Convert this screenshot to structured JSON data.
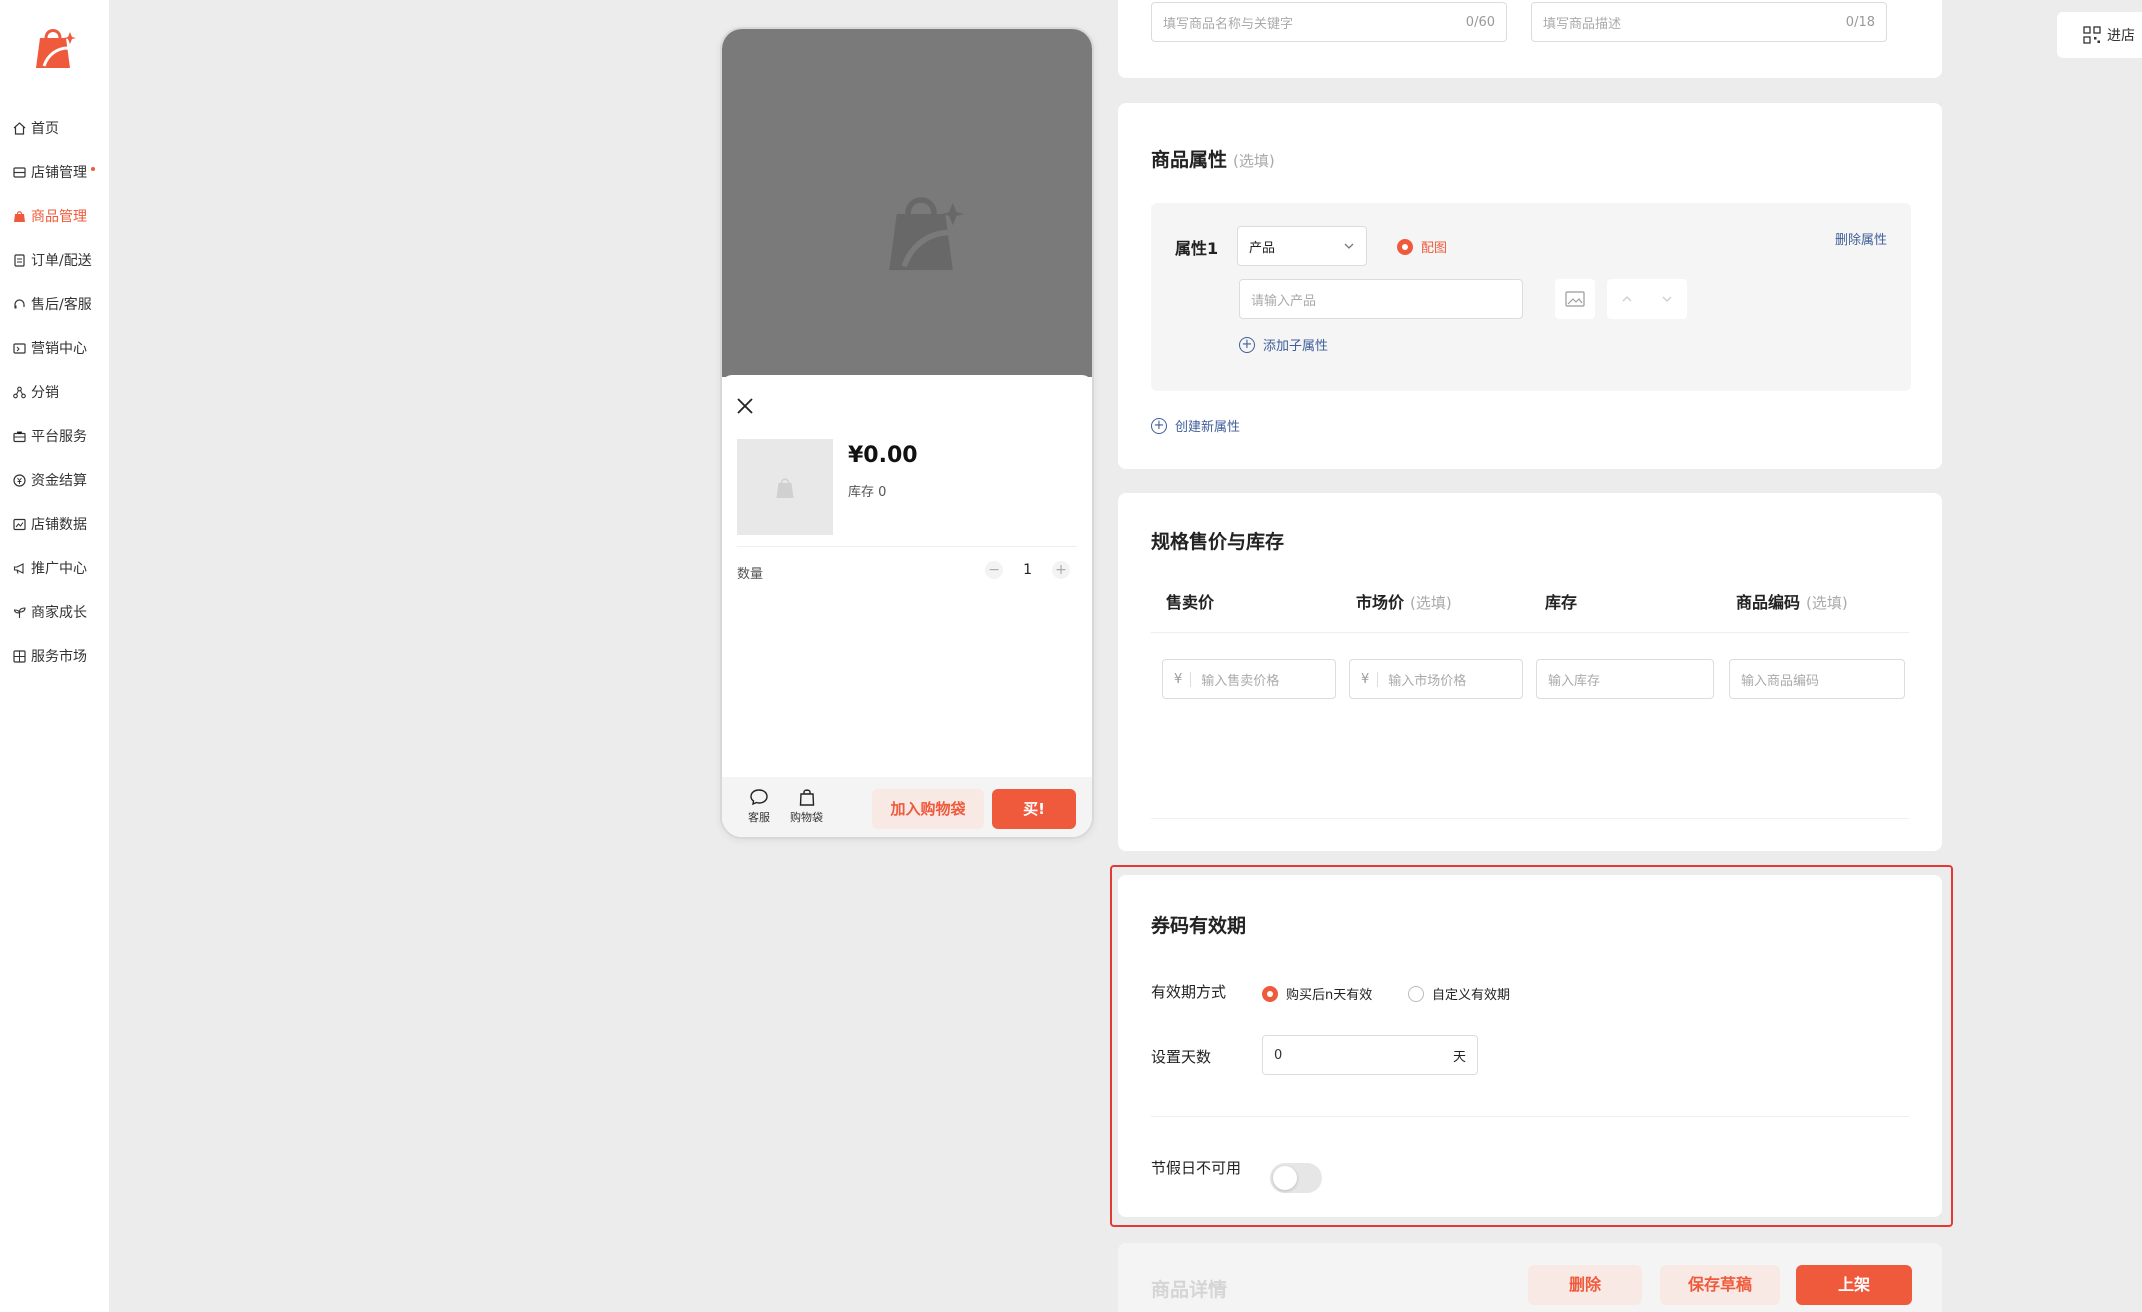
{
  "sidebar": {
    "items": [
      {
        "label": "首页",
        "icon": "home-icon"
      },
      {
        "label": "店铺管理",
        "icon": "store-icon",
        "dot": true
      },
      {
        "label": "商品管理",
        "icon": "goods-icon",
        "active": true
      },
      {
        "label": "订单/配送",
        "icon": "order-icon"
      },
      {
        "label": "售后/客服",
        "icon": "headset-icon"
      },
      {
        "label": "营销中心",
        "icon": "marketing-icon"
      },
      {
        "label": "分销",
        "icon": "distribution-icon"
      },
      {
        "label": "平台服务",
        "icon": "briefcase-icon"
      },
      {
        "label": "资金结算",
        "icon": "money-icon"
      },
      {
        "label": "店铺数据",
        "icon": "chart-icon"
      },
      {
        "label": "推广中心",
        "icon": "megaphone-icon"
      },
      {
        "label": "商家成长",
        "icon": "sprout-icon"
      },
      {
        "label": "服务市场",
        "icon": "grid-icon"
      }
    ]
  },
  "colors": {
    "accent": "#f05a3c",
    "link": "#3f5e9a",
    "highlight": "#e53935"
  },
  "preview": {
    "price": "¥0.00",
    "stock": "库存 0",
    "qty_label": "数量",
    "qty_minus": "−",
    "qty_value": "1",
    "qty_plus": "+",
    "service_label": "客服",
    "bag_label": "购物袋",
    "add_cart": "加入购物袋",
    "buy": "买!"
  },
  "basic": {
    "name_placeholder": "填写商品名称与关键字",
    "name_counter": "0/60",
    "desc_placeholder": "填写商品描述",
    "desc_counter": "0/18"
  },
  "attributes": {
    "title": "商品属性",
    "optional": "(选填)",
    "attr_label": "属性1",
    "attr_select": "产品",
    "image_toggle": "配图",
    "delete_attr": "删除属性",
    "value_placeholder": "请输入产品",
    "add_sub": "添加子属性",
    "create_new": "创建新属性"
  },
  "pricing": {
    "title": "规格售价与库存",
    "col_price": "售卖价",
    "col_market": "市场价",
    "col_market_opt": "(选填)",
    "col_stock": "库存",
    "col_code": "商品编码",
    "col_code_opt": "(选填)",
    "currency": "¥",
    "price_placeholder": "输入售卖价格",
    "market_placeholder": "输入市场价格",
    "stock_placeholder": "输入库存",
    "code_placeholder": "输入商品编码"
  },
  "validity": {
    "title": "券码有效期",
    "mode_label": "有效期方式",
    "option1": "购买后n天有效",
    "option2": "自定义有效期",
    "days_label": "设置天数",
    "days_value": "0",
    "days_unit": "天",
    "holiday_label": "节假日不可用",
    "holiday_enabled": false
  },
  "details": {
    "title": "商品详情"
  },
  "actions": {
    "delete": "删除",
    "save_draft": "保存草稿",
    "publish": "上架"
  },
  "qr_tab": {
    "label": "进店"
  }
}
